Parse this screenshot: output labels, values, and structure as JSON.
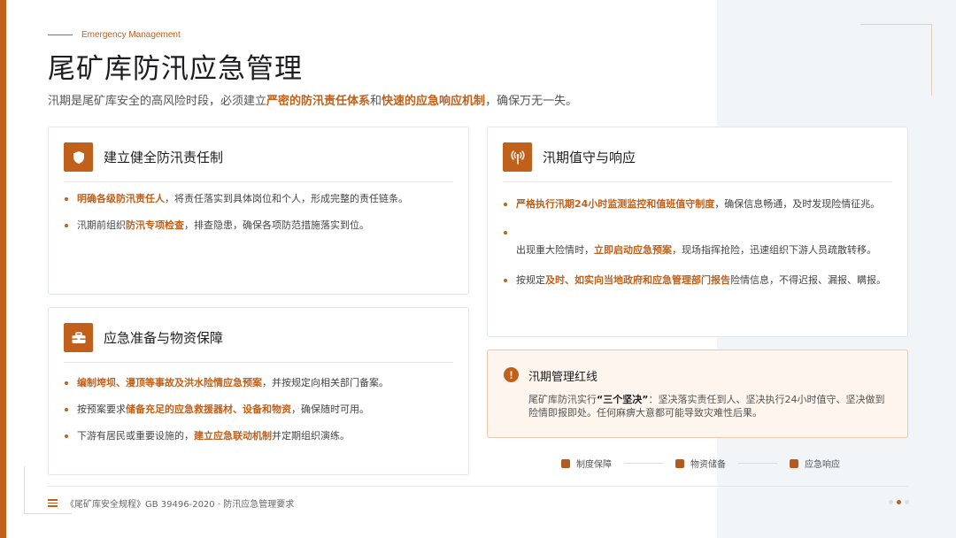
{
  "header": {
    "eyebrow": "Emergency Management",
    "title": "尾矿库防汛应急管理",
    "subtitle": {
      "pre": "汛期是尾矿库安全的高风险时段，必须建立",
      "hl1": "严密的防汛责任体系",
      "mid": "和",
      "hl2": "快速的应急响应机制",
      "post": "，确保万无一失。"
    }
  },
  "cards": {
    "responsibility": {
      "icon": "shield-icon",
      "title": "建立健全防汛责任制",
      "items": [
        {
          "pre": "",
          "hl": "明确各级防汛责任人",
          "post": "，将责任落实到具体岗位和个人，形成完整的责任链条。"
        },
        {
          "pre": "汛期前组织",
          "hl": "防汛专项检查",
          "post": "，排查隐患，确保各项防范措施落实到位。"
        }
      ]
    },
    "preparedness": {
      "icon": "toolbox-icon",
      "title": "应急准备与物资保障",
      "items": [
        {
          "pre": "",
          "hl": "编制垮坝、漫顶等事故及洪水险情应急预案",
          "post": "，并按规定向相关部门备案。"
        },
        {
          "pre": "按预案要求",
          "hl": "储备充足的应急救援器材、设备和物资",
          "post": "，确保随时可用。"
        },
        {
          "pre": "下游有居民或重要设施的，",
          "hl": "建立应急联动机制",
          "post": "并定期组织演练。"
        }
      ]
    },
    "response": {
      "icon": "signal-tower-icon",
      "title": "汛期值守与响应",
      "items": [
        {
          "pre": "",
          "hl": "严格执行汛期24小时监测监控和值班值守制度",
          "post": "，确保信息畅通，及时发现险情征兆。"
        },
        {
          "pre": "出现重大险情时，",
          "hl": "立即启动应急预案",
          "post": "，现场指挥抢险，迅速组织下游人员疏散转移。"
        },
        {
          "pre": "按规定",
          "hl": "及时、如实向当地政府和应急管理部门报告",
          "post": "险情信息，不得迟报、漏报、瞒报。"
        }
      ]
    }
  },
  "alert": {
    "icon": "exclamation-icon",
    "title": "汛期管理红线",
    "pre": "尾矿库防汛实行",
    "bold": "“三个坚决”",
    "post": "：坚决落实责任到人、坚决执行24小时值守、坚决做到险情即报即处。任何麻痹大意都可能导致灾难性后果。"
  },
  "legend": [
    "制度保障",
    "物资储备",
    "应急响应"
  ],
  "footer": {
    "source": "《尾矿库安全规程》GB 39496-2020 · 防汛应急管理要求"
  },
  "pager": {
    "total": 3,
    "current": 2
  },
  "colors": {
    "accent": "#c0601a",
    "panel": "#f1f5f8",
    "alert_bg": "#fdf5ee"
  }
}
